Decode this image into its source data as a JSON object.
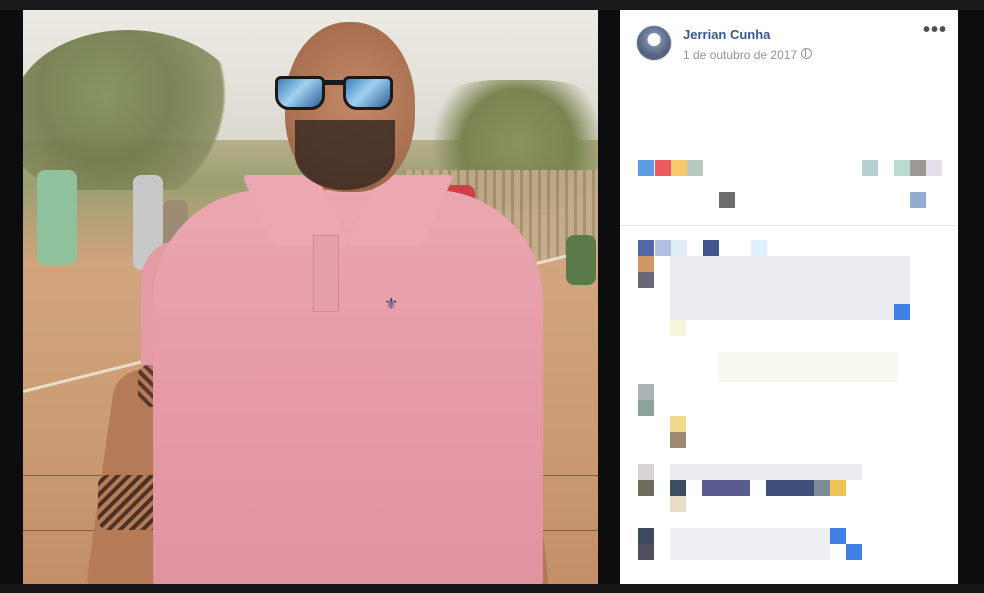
{
  "post": {
    "author": "Jerrian Cunha",
    "date": "1 de outubro de 2017",
    "privacy_icon": "globe-icon",
    "menu_icon": "more-options-icon",
    "more_label": "•••"
  },
  "photo": {
    "subject": "man-pink-polo-sunglasses"
  },
  "colors": {
    "link": "#365899",
    "meta": "#90949c",
    "panel_bg": "#ffffff",
    "page_bg": "#0d0d0f"
  }
}
